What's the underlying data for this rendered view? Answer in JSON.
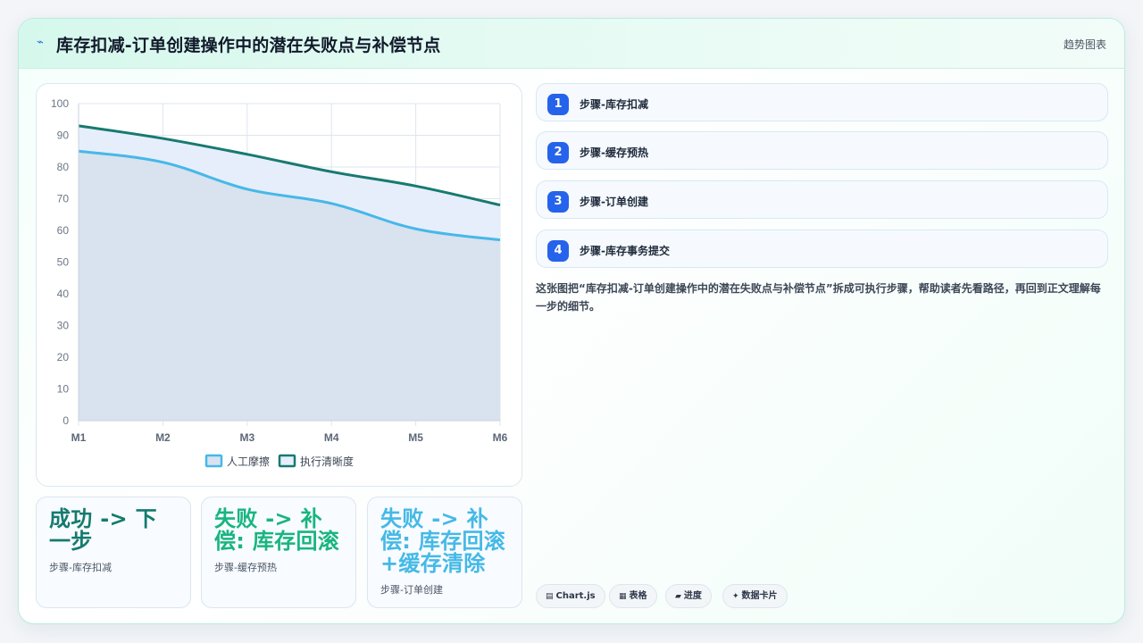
{
  "header": {
    "title": "库存扣减-订单创建操作中的潜在失败点与补偿节点",
    "tag": "趋势图表",
    "logo_icon": "pulse-icon"
  },
  "chart_data": {
    "type": "area",
    "categories": [
      "M1",
      "M2",
      "M3",
      "M4",
      "M5",
      "M6"
    ],
    "ylim": [
      0,
      100
    ],
    "yticks": [
      0,
      10,
      20,
      30,
      40,
      50,
      60,
      70,
      80,
      90,
      100
    ],
    "grid": true,
    "legend_position": "bottom",
    "series": [
      {
        "name": "人工摩擦",
        "values": [
          85,
          81.5,
          73,
          68.5,
          60.5,
          57
        ],
        "color": "#46b8e8",
        "fill": "#d9e2ef"
      },
      {
        "name": "执行清晰度",
        "values": [
          93,
          89,
          84,
          78.5,
          74,
          68
        ],
        "color": "#177a70",
        "fill": "#e7eefb"
      }
    ]
  },
  "kpis": [
    {
      "value": "成功 -> 下一步",
      "label": "步骤-库存扣减",
      "color": "#157a6e"
    },
    {
      "value": "失败 -> 补偿: 库存回滚",
      "label": "步骤-缓存预热",
      "color": "#19b57f"
    },
    {
      "value": "失败 -> 补偿: 库存回滚+缓存清除",
      "label": "步骤-订单创建",
      "color": "#45b9e6"
    }
  ],
  "steps": [
    {
      "num": "1",
      "label": "步骤-库存扣减"
    },
    {
      "num": "2",
      "label": "步骤-缓存预热"
    },
    {
      "num": "3",
      "label": "步骤-订单创建"
    },
    {
      "num": "4",
      "label": "步骤-库存事务提交"
    }
  ],
  "description": "这张图把“库存扣减-订单创建操作中的潜在失败点与补偿节点”拆成可执行步骤，帮助读者先看路径，再回到正文理解每一步的细节。",
  "chips": [
    {
      "icon": "▤",
      "label": "Chart.js"
    },
    {
      "icon": "▦",
      "label": "表格"
    },
    {
      "icon": "▰",
      "label": "进度"
    },
    {
      "icon": "✦",
      "label": "数据卡片"
    }
  ],
  "colors": {
    "accent": "#2563eb",
    "brand_green": "#157a6e"
  }
}
